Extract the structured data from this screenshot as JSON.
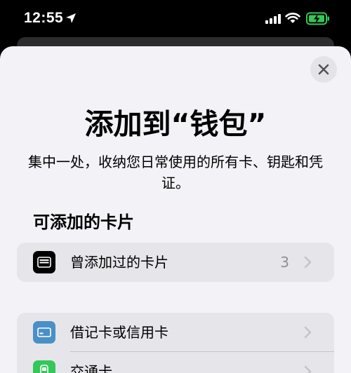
{
  "status_bar": {
    "time": "12:55",
    "icons": [
      "location-arrow-icon",
      "cellular-signal-icon",
      "wifi-icon",
      "battery-charging-icon"
    ],
    "battery_color": "#34c759"
  },
  "sheet": {
    "close_icon": "close-icon",
    "title": "添加到“钱包”",
    "subtitle": "集中一处，收纳您日常使用的所有卡、钥匙和凭证。"
  },
  "section": {
    "header": "可添加的卡片",
    "previous_cards": {
      "label": "曾添加过的卡片",
      "count": "3",
      "icon": "wallet-icon",
      "icon_color": "#000000"
    }
  },
  "card_types": [
    {
      "label": "借记卡或信用卡",
      "icon": "credit-card-icon",
      "icon_color": "#4a90c8"
    },
    {
      "label": "交通卡",
      "icon": "transit-card-icon",
      "icon_color": "#34c759"
    }
  ]
}
